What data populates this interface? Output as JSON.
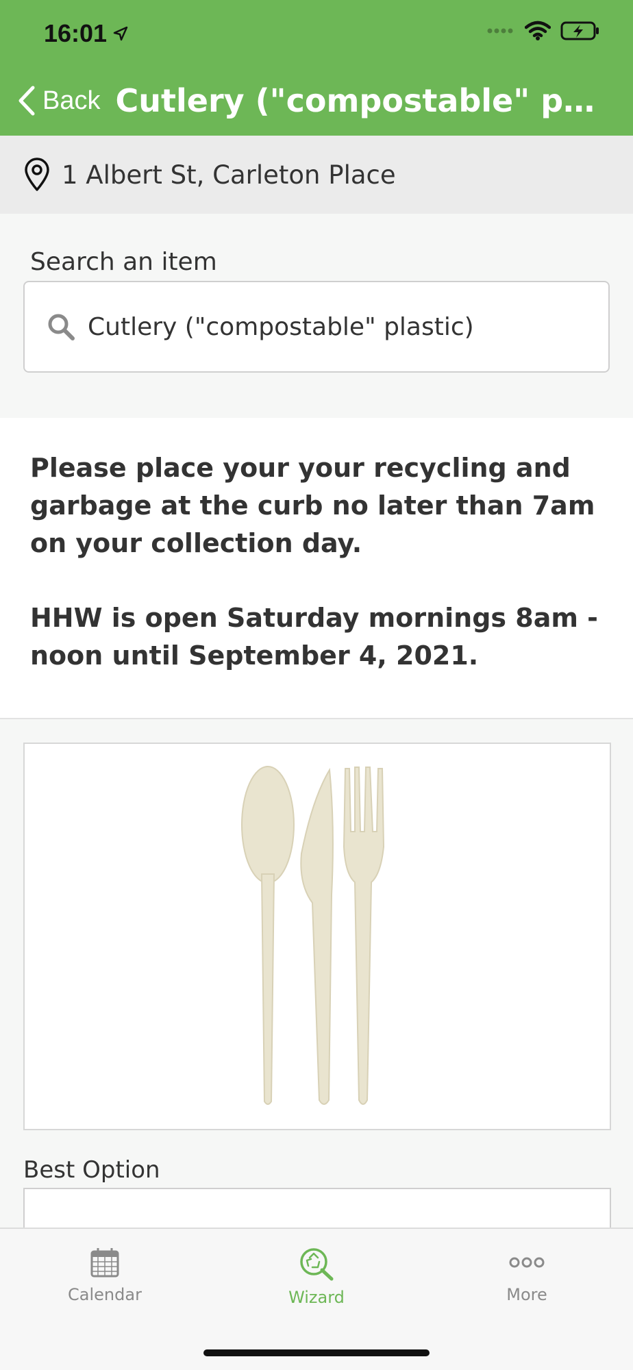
{
  "status_bar": {
    "time": "16:01"
  },
  "nav": {
    "back_label": "Back",
    "title": "Cutlery (\"compostable\" plast..."
  },
  "location": {
    "address": "1 Albert St, Carleton Place"
  },
  "search": {
    "label": "Search an item",
    "value": "Cutlery (\"compostable\" plastic)"
  },
  "notice": {
    "paragraph_1": "Please place your your recycling and garbage at the curb no later than 7am on your collection day.",
    "paragraph_2": "HHW is open Saturday mornings 8am - noon until September 4, 2021."
  },
  "result": {
    "best_option_label": "Best Option"
  },
  "tabs": [
    {
      "label": "Calendar",
      "icon": "calendar-icon",
      "active": false
    },
    {
      "label": "Wizard",
      "icon": "recycle-search-icon",
      "active": true
    },
    {
      "label": "More",
      "icon": "more-dots-icon",
      "active": false
    }
  ],
  "colors": {
    "brand_green": "#6db756",
    "tab_inactive": "#8a8a8a"
  }
}
